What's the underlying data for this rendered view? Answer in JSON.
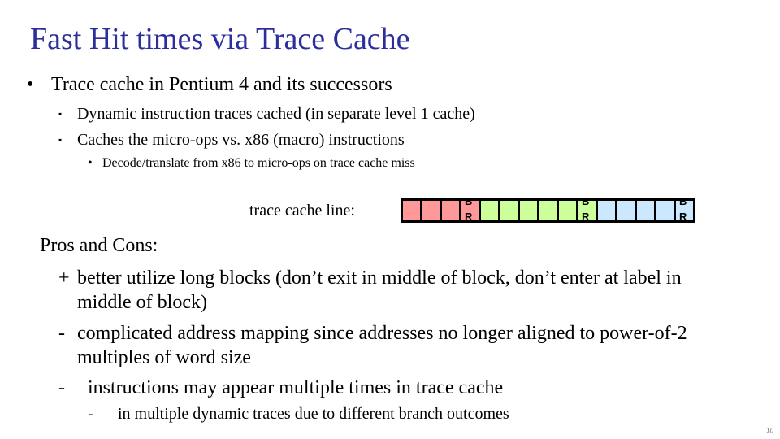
{
  "slide": {
    "title": "Fast Hit times via Trace Cache",
    "bullets": [
      {
        "marker": "•",
        "text": "Trace cache in Pentium 4 and its successors"
      },
      {
        "marker": "▪",
        "text": "Dynamic instruction traces cached (in separate level 1 cache)"
      },
      {
        "marker": "▪",
        "text": "Caches the micro-ops vs. x86 (macro) instructions"
      },
      {
        "marker": "•",
        "text": "Decode/translate from x86 to micro-ops on trace cache miss"
      }
    ],
    "trace_line": {
      "label": "trace cache line:",
      "branch_label_top": "B",
      "branch_label_bottom": "R",
      "colors": {
        "red": "#ff9999",
        "green": "#ccff99",
        "blue": "#cce8ff"
      },
      "cells": [
        "red",
        "red",
        "red",
        "red-br",
        "green",
        "green",
        "green",
        "green",
        "green",
        "green-br",
        "blue",
        "blue",
        "blue",
        "blue",
        "blue-br"
      ]
    },
    "pros_cons": {
      "title": "Pros and Cons:",
      "items": [
        {
          "marker": "+",
          "line1": "better utilize long blocks (don’t exit in middle of block, don’t enter at label in",
          "line2": "middle of block)"
        },
        {
          "marker": "-",
          "line1": "complicated address mapping since addresses no longer aligned to power-of-2",
          "line2": "multiples of word size"
        },
        {
          "marker": "-",
          "line1": "instructions may appear multiple times in trace cache"
        },
        {
          "marker": "-",
          "line1": "in multiple dynamic traces due to different branch outcomes"
        }
      ]
    },
    "page_number": "10"
  }
}
